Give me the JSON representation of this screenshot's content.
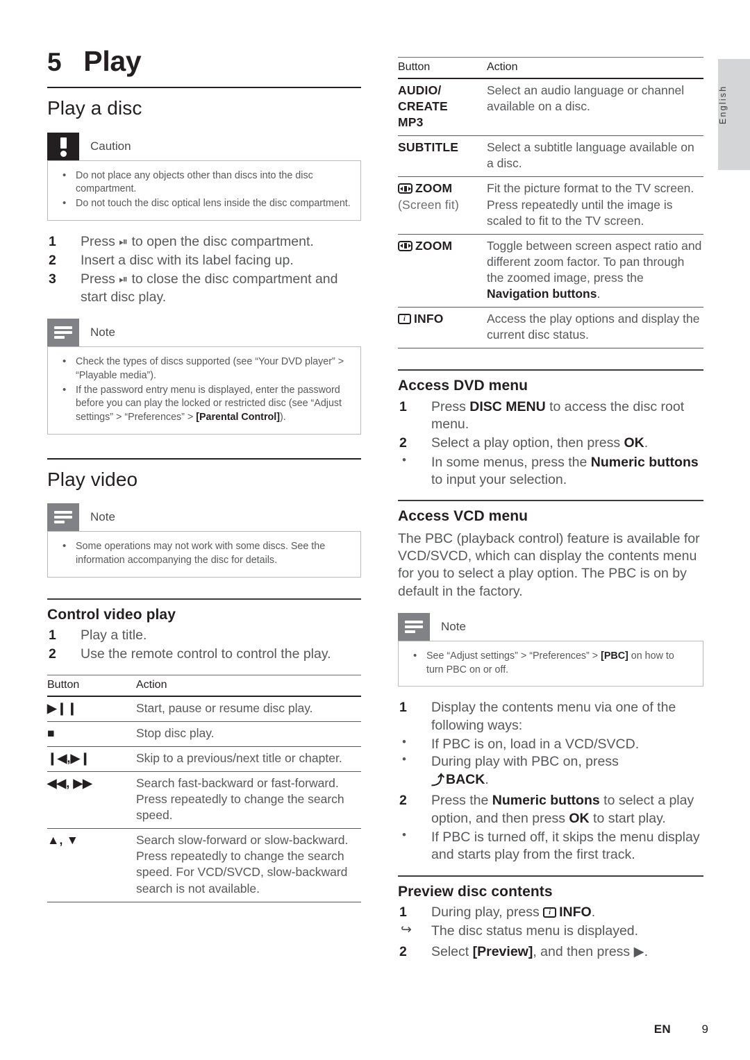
{
  "language_tab": "English",
  "footer": {
    "locale": "EN",
    "page": "9"
  },
  "chapter": {
    "number": "5",
    "title": "Play"
  },
  "left": {
    "section_play_a_disc": "Play a disc",
    "caution": {
      "title": "Caution",
      "items": [
        "Do not place any objects other than discs into the disc compartment.",
        "Do not touch the disc optical lens inside the disc compartment."
      ]
    },
    "disc_steps": [
      {
        "n": "1",
        "text": "Press ⏏ to open the disc compartment."
      },
      {
        "n": "2",
        "text": "Insert a disc with its label facing up."
      },
      {
        "n": "3",
        "text": "Press ⏏ to close the disc compartment and start disc play."
      }
    ],
    "note1": {
      "title": "Note",
      "items": [
        "Check the types of discs supported (see “Your DVD player” > “Playable media”).",
        "If the password entry menu is displayed, enter the password before you can play the locked or restricted disc (see “Adjust settings” > “Preferences” > [Parental Control])."
      ]
    },
    "section_play_video": "Play video",
    "note2": {
      "title": "Note",
      "items": [
        "Some operations may not work with some discs. See the information accompanying the disc for details."
      ]
    },
    "subsection_control_video_play": "Control video play",
    "control_steps": [
      {
        "n": "1",
        "text": "Play a title."
      },
      {
        "n": "2",
        "text": "Use the remote control to control the play."
      }
    ],
    "table": {
      "headers": [
        "Button",
        "Action"
      ],
      "rows": [
        {
          "button": "▶❙❙",
          "button_name": "play-pause-button",
          "action": "Start, pause or resume disc play."
        },
        {
          "button": "■",
          "button_name": "stop-button",
          "action": "Stop disc play."
        },
        {
          "button": "❙◀,▶❙",
          "button_name": "skip-buttons",
          "action": "Skip to a previous/next title or chapter."
        },
        {
          "button": "◀◀, ▶▶",
          "button_name": "search-fast-buttons",
          "action": "Search fast-backward or fast-forward. Press repeatedly to change the search speed."
        },
        {
          "button": "▲, ▼",
          "button_name": "search-slow-buttons",
          "action": "Search slow-forward or slow-backward. Press repeatedly to change the search speed. For VCD/SVCD, slow-backward search is not available."
        }
      ]
    }
  },
  "right": {
    "table": {
      "headers": [
        "Button",
        "Action"
      ],
      "rows": [
        {
          "button": "AUDIO/ CREATE MP3",
          "button_name": "audio-create-mp3-button",
          "action": "Select an audio language or channel available on a disc."
        },
        {
          "button": "SUBTITLE",
          "button_name": "subtitle-button",
          "action": "Select a subtitle language available on a disc."
        },
        {
          "button": "ZOOM",
          "button_sub": "(Screen fit)",
          "button_name": "zoom-screen-fit-button",
          "action": "Fit the picture format to the TV screen. Press repeatedly until the image is scaled to fit to the TV screen."
        },
        {
          "button": "ZOOM",
          "button_name": "zoom-button",
          "action": "Toggle between screen aspect ratio and different zoom factor. To pan through the zoomed image, press the Navigation buttons."
        },
        {
          "button": "INFO",
          "button_name": "info-button",
          "action": "Access the play options and display the current disc status."
        }
      ]
    },
    "subsection_access_dvd_menu": "Access DVD menu",
    "dvd_steps": [
      {
        "n": "1",
        "text": "Press DISC MENU to access the disc root menu."
      },
      {
        "n": "2",
        "text": "Select a play option, then press OK."
      }
    ],
    "dvd_substeps": [
      "In some menus, press the Numeric buttons to input your selection."
    ],
    "subsection_access_vcd_menu": "Access VCD menu",
    "vcd_paragraph": "The PBC (playback control) feature is available for VCD/SVCD, which can display the contents menu for you to select a play option. The PBC is on by default in the factory.",
    "note3": {
      "title": "Note",
      "items": [
        "See “Adjust settings” > “Preferences” > [PBC] on how to turn PBC on or off."
      ]
    },
    "vcd_step1": {
      "n": "1",
      "text": "Display the contents menu via one of the following ways:"
    },
    "vcd_step1_bullets": [
      "If PBC is on, load in a VCD/SVCD.",
      "During play with PBC on, press ↩ BACK."
    ],
    "vcd_step2": {
      "n": "2",
      "text": "Press the Numeric buttons to select a play option, and then press OK to start play."
    },
    "vcd_step2_bullets": [
      "If PBC is turned off, it skips the menu display and starts play from the first track."
    ],
    "subsection_preview_disc_contents": "Preview disc contents",
    "preview_step1": {
      "n": "1",
      "text": "During play, press ⓘ INFO."
    },
    "preview_step1_result": "The disc status menu is displayed.",
    "preview_step2": {
      "n": "2",
      "text": "Select [Preview], and then press ▶."
    }
  }
}
